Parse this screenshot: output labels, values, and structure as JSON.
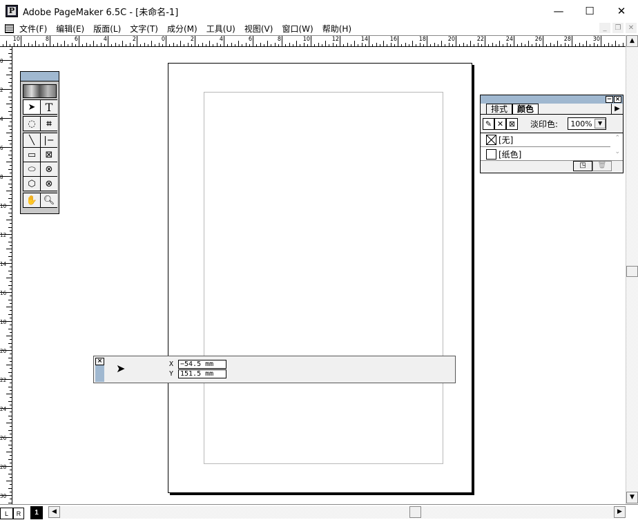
{
  "window": {
    "title": "Adobe PageMaker 6.5C - [未命名-1]",
    "minimize": "—",
    "maximize": "☐",
    "close": "✕"
  },
  "menu": [
    "文件(F)",
    "编辑(E)",
    "版面(L)",
    "文字(T)",
    "成分(M)",
    "工具(U)",
    "视图(V)",
    "窗口(W)",
    "帮助(H)"
  ],
  "mdi": {
    "minimize": "_",
    "restore": "❐",
    "close": "✕"
  },
  "ruler": {
    "horizontal": [
      "10",
      "8",
      "6",
      "4",
      "2",
      "0",
      "2",
      "4",
      "6",
      "8",
      "10",
      "12",
      "14",
      "16",
      "18",
      "20",
      "22",
      "24",
      "26",
      "28",
      "30",
      "3"
    ],
    "vertical": [
      "0",
      "2",
      "4",
      "6",
      "8",
      "10",
      "12",
      "14",
      "16",
      "18",
      "20",
      "22",
      "24",
      "26",
      "28",
      "30"
    ]
  },
  "toolbox": {
    "tools": [
      "pointer",
      "text",
      "rotate",
      "crop",
      "line",
      "constrained-line",
      "rectangle",
      "rectangle-frame",
      "ellipse",
      "ellipse-frame",
      "polygon",
      "polygon-frame",
      "hand",
      "zoom"
    ]
  },
  "colors_panel": {
    "tabs": [
      "排式",
      "颜色"
    ],
    "tint_label": "淡印色:",
    "tint_value": "100%",
    "items": [
      "[无]",
      "[纸色]"
    ]
  },
  "control_palette": {
    "x_label": "X",
    "x_value": "−54.5 mm",
    "y_label": "Y",
    "y_value": "151.5 mm"
  },
  "pages": {
    "left": "L",
    "right": "R",
    "current": "1"
  }
}
